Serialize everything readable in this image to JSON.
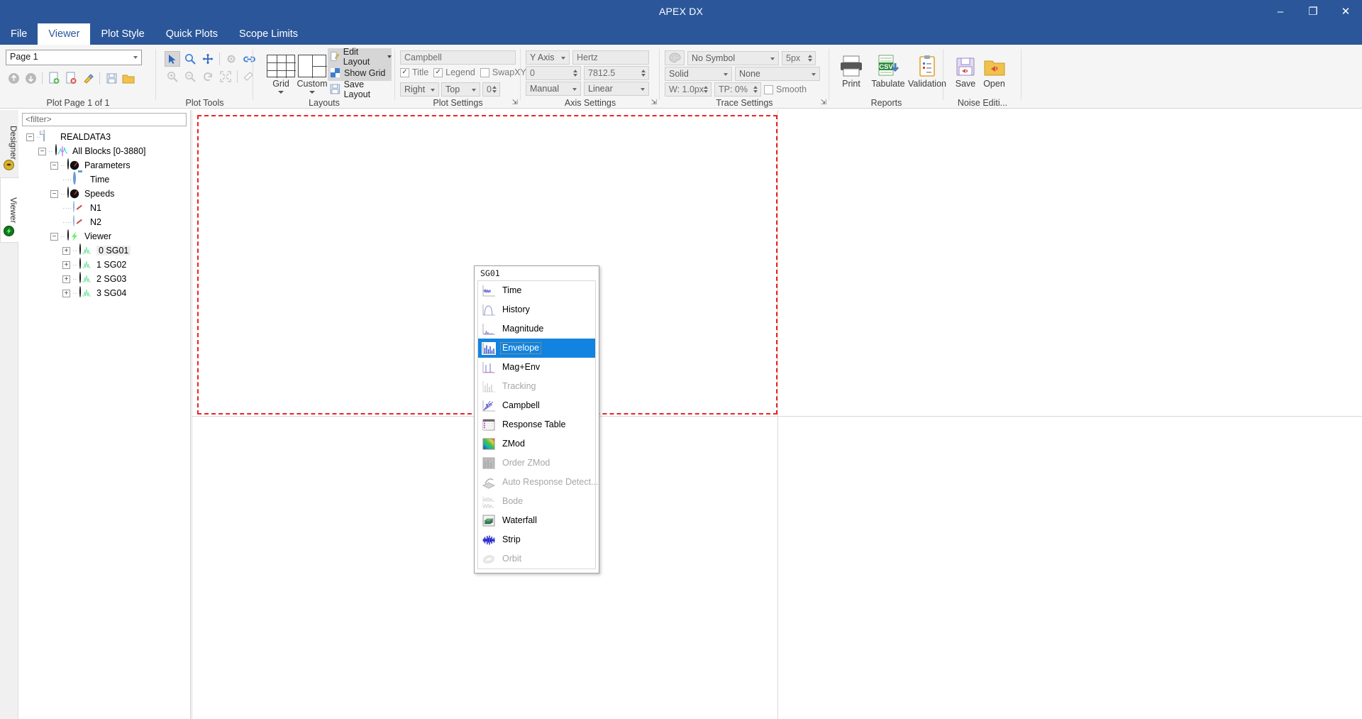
{
  "window": {
    "title": "APEX DX",
    "minimize": "–",
    "restore": "❐",
    "close": "✕"
  },
  "tabs": [
    {
      "label": "File",
      "active": false
    },
    {
      "label": "Viewer",
      "active": true
    },
    {
      "label": "Plot Style",
      "active": false
    },
    {
      "label": "Quick Plots",
      "active": false
    },
    {
      "label": "Scope Limits",
      "active": false
    }
  ],
  "tab_right": {
    "viewer_label": "Viewer",
    "icon": "green-orb-icon",
    "restore_btn": "▱",
    "minimize_btn": "▬"
  },
  "ribbon": {
    "groups": [
      {
        "name": "plot-page",
        "label": "Plot Page 1 of 1"
      },
      {
        "name": "plot-tools",
        "label": "Plot Tools"
      },
      {
        "name": "layouts",
        "label": "Layouts"
      },
      {
        "name": "plot-settings",
        "label": "Plot Settings",
        "launcher": true
      },
      {
        "name": "axis-settings",
        "label": "Axis Settings",
        "launcher": true
      },
      {
        "name": "trace-settings",
        "label": "Trace Settings",
        "launcher": true
      },
      {
        "name": "reports",
        "label": "Reports"
      },
      {
        "name": "noise-editing",
        "label": "Noise Editi..."
      }
    ],
    "plot_page": {
      "page_combo_value": "Page 1",
      "icons": [
        "page-up-icon",
        "page-down-icon",
        "new-page-icon",
        "delete-page-icon",
        "clear-page-icon",
        "save-page-icon",
        "open-page-icon"
      ]
    },
    "plot_tools": {
      "icons_row1": [
        "pointer-icon",
        "zoom-icon",
        "pan-icon",
        "settings-icon",
        "link-icon"
      ],
      "icons_row2": [
        "zoom-in-icon",
        "zoom-out-icon",
        "redo-icon",
        "fit-icon",
        "eraser-icon"
      ]
    },
    "layouts": {
      "grid_label": "Grid",
      "custom_label": "Custom",
      "edit_layout": "Edit Layout",
      "show_grid": "Show Grid",
      "save_layout": "Save Layout"
    },
    "plot_settings": {
      "title_value": "Campbell",
      "title_check": {
        "label": "Title",
        "checked": true
      },
      "legend_check": {
        "label": "Legend",
        "checked": true
      },
      "swapxy_check": {
        "label": "SwapXY",
        "checked": false
      },
      "legend_h": "Right",
      "legend_v": "Top",
      "legend_offset": "0"
    },
    "axis_settings": {
      "axis_select": "Y Axis",
      "unit_value": "Hertz",
      "min_value": "0",
      "max_value": "7812.5",
      "scale_mode": "Manual",
      "scale_type": "Linear"
    },
    "trace_settings": {
      "palette_icon": "palette-icon",
      "symbol": "No Symbol",
      "symbol_size": "5px",
      "line_style": "Solid",
      "fill": "None",
      "width": "W: 1.0px",
      "transparency": "TP: 0%",
      "smooth_check": {
        "label": "Smooth",
        "checked": false
      }
    },
    "reports": [
      {
        "label": "Print",
        "icon": "printer-icon"
      },
      {
        "label": "Tabulate",
        "icon": "csv-export-icon"
      },
      {
        "label": "Validation",
        "icon": "clipboard-icon"
      }
    ],
    "noise_editing": [
      {
        "label": "Save",
        "icon": "save-noise-icon"
      },
      {
        "label": "Open",
        "icon": "open-noise-icon"
      }
    ]
  },
  "left_rail": {
    "designer_label": "Designer",
    "viewer_label": "Viewer"
  },
  "tree_panel": {
    "filter_placeholder": "<filter>",
    "nodes": [
      {
        "label": "REALDATA3",
        "depth": 0,
        "expander": "minus",
        "icon": "document-icon"
      },
      {
        "label": "All Blocks [0-3880]",
        "depth": 1,
        "expander": "minus",
        "icon": "waveform-disc-icon"
      },
      {
        "label": "Parameters",
        "depth": 2,
        "expander": "minus",
        "icon": "gauge-disc-icon"
      },
      {
        "label": "Time",
        "depth": 3,
        "expander": "none",
        "icon": "stopwatch-icon"
      },
      {
        "label": "Speeds",
        "depth": 2,
        "expander": "minus",
        "icon": "gauge-disc-icon"
      },
      {
        "label": "N1",
        "depth": 3,
        "expander": "none",
        "icon": "gauge-icon"
      },
      {
        "label": "N2",
        "depth": 3,
        "expander": "none",
        "icon": "gauge-icon"
      },
      {
        "label": "Viewer",
        "depth": 2,
        "expander": "minus",
        "icon": "green-orb-icon"
      },
      {
        "label": "0 SG01",
        "depth": 3,
        "expander": "plus",
        "icon": "signal-disc-navy-icon",
        "selected": true
      },
      {
        "label": "1 SG02",
        "depth": 3,
        "expander": "plus",
        "icon": "signal-disc-green-icon"
      },
      {
        "label": "2 SG03",
        "depth": 3,
        "expander": "plus",
        "icon": "signal-disc-green-icon"
      },
      {
        "label": "3 SG04",
        "depth": 3,
        "expander": "plus",
        "icon": "signal-disc-green-icon"
      }
    ]
  },
  "context_menu": {
    "title": "SG01",
    "items": [
      {
        "label": "Time",
        "icon": "time-plot-icon",
        "enabled": true,
        "selected": false
      },
      {
        "label": "History",
        "icon": "history-plot-icon",
        "enabled": true,
        "selected": false
      },
      {
        "label": "Magnitude",
        "icon": "magnitude-plot-icon",
        "enabled": true,
        "selected": false
      },
      {
        "label": "Envelope",
        "icon": "envelope-plot-icon",
        "enabled": true,
        "selected": true
      },
      {
        "label": "Mag+Env",
        "icon": "mag-env-plot-icon",
        "enabled": true,
        "selected": false
      },
      {
        "label": "Tracking",
        "icon": "tracking-plot-icon",
        "enabled": false,
        "selected": false
      },
      {
        "label": "Campbell",
        "icon": "campbell-plot-icon",
        "enabled": true,
        "selected": false
      },
      {
        "label": "Response Table",
        "icon": "response-table-icon",
        "enabled": true,
        "selected": false
      },
      {
        "label": "ZMod",
        "icon": "zmod-plot-icon",
        "enabled": true,
        "selected": false
      },
      {
        "label": "Order ZMod",
        "icon": "order-zmod-icon",
        "enabled": false,
        "selected": false
      },
      {
        "label": "Auto Response Detect...",
        "icon": "auto-response-icon",
        "enabled": false,
        "selected": false
      },
      {
        "label": "Bode",
        "icon": "bode-plot-icon",
        "enabled": false,
        "selected": false
      },
      {
        "label": "Waterfall",
        "icon": "waterfall-plot-icon",
        "enabled": true,
        "selected": false
      },
      {
        "label": "Strip",
        "icon": "strip-plot-icon",
        "enabled": true,
        "selected": false
      },
      {
        "label": "Orbit",
        "icon": "orbit-plot-icon",
        "enabled": false,
        "selected": false
      }
    ]
  },
  "colors": {
    "title_bar": "#2b579a",
    "accent_selection": "#1283e0",
    "plot_selection_border": "#ee2222",
    "ribbon_bg": "#f5f5f5"
  }
}
